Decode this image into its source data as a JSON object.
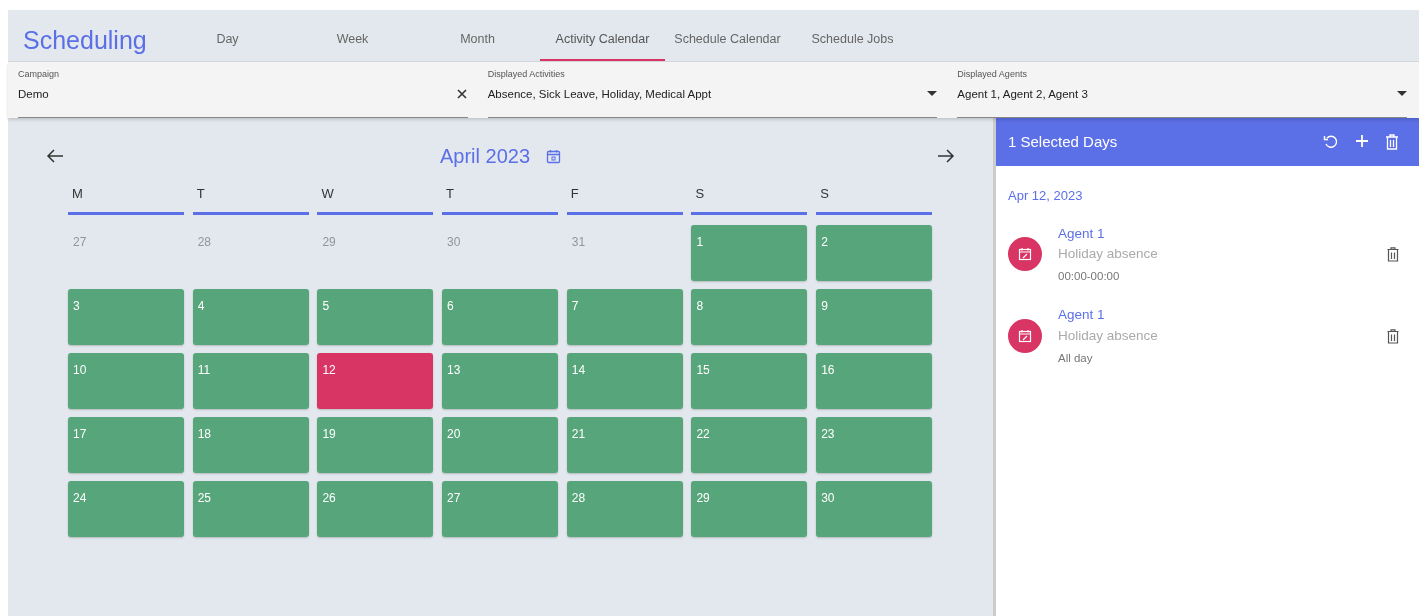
{
  "app_title": "Scheduling",
  "tabs": [
    {
      "label": "Day",
      "selected": false
    },
    {
      "label": "Week",
      "selected": false
    },
    {
      "label": "Month",
      "selected": false
    },
    {
      "label": "Activity Calendar",
      "selected": true
    },
    {
      "label": "Schedule Calendar",
      "selected": false
    },
    {
      "label": "Schedule Jobs",
      "selected": false
    }
  ],
  "filters": [
    {
      "label": "Campaign",
      "value": "Demo",
      "kind": "clearable"
    },
    {
      "label": "Displayed Activities",
      "value": "Absence, Sick Leave, Holiday, Medical Appt",
      "kind": "dropdown"
    },
    {
      "label": "Displayed Agents",
      "value": "Agent 1, Agent 2, Agent 3",
      "kind": "dropdown"
    }
  ],
  "calendar": {
    "month": "April 2023",
    "weekdays": [
      "M",
      "T",
      "W",
      "T",
      "F",
      "S",
      "S"
    ],
    "days": [
      {
        "day": "27",
        "kind": "outside",
        "selected": false
      },
      {
        "day": "28",
        "kind": "outside",
        "selected": false
      },
      {
        "day": "29",
        "kind": "outside",
        "selected": false
      },
      {
        "day": "30",
        "kind": "outside",
        "selected": false
      },
      {
        "day": "31",
        "kind": "outside",
        "selected": false
      },
      {
        "day": "1",
        "kind": "current",
        "selected": false
      },
      {
        "day": "2",
        "kind": "current",
        "selected": false
      },
      {
        "day": "3",
        "kind": "current",
        "selected": false
      },
      {
        "day": "4",
        "kind": "current",
        "selected": false
      },
      {
        "day": "5",
        "kind": "current",
        "selected": false
      },
      {
        "day": "6",
        "kind": "current",
        "selected": false
      },
      {
        "day": "7",
        "kind": "current",
        "selected": false
      },
      {
        "day": "8",
        "kind": "current",
        "selected": false
      },
      {
        "day": "9",
        "kind": "current",
        "selected": false
      },
      {
        "day": "10",
        "kind": "current",
        "selected": false
      },
      {
        "day": "11",
        "kind": "current",
        "selected": false
      },
      {
        "day": "12",
        "kind": "current",
        "selected": true
      },
      {
        "day": "13",
        "kind": "current",
        "selected": false
      },
      {
        "day": "14",
        "kind": "current",
        "selected": false
      },
      {
        "day": "15",
        "kind": "current",
        "selected": false
      },
      {
        "day": "16",
        "kind": "current",
        "selected": false
      },
      {
        "day": "17",
        "kind": "current",
        "selected": false
      },
      {
        "day": "18",
        "kind": "current",
        "selected": false
      },
      {
        "day": "19",
        "kind": "current",
        "selected": false
      },
      {
        "day": "20",
        "kind": "current",
        "selected": false
      },
      {
        "day": "21",
        "kind": "current",
        "selected": false
      },
      {
        "day": "22",
        "kind": "current",
        "selected": false
      },
      {
        "day": "23",
        "kind": "current",
        "selected": false
      },
      {
        "day": "24",
        "kind": "current",
        "selected": false
      },
      {
        "day": "25",
        "kind": "current",
        "selected": false
      },
      {
        "day": "26",
        "kind": "current",
        "selected": false
      },
      {
        "day": "27",
        "kind": "current",
        "selected": false
      },
      {
        "day": "28",
        "kind": "current",
        "selected": false
      },
      {
        "day": "29",
        "kind": "current",
        "selected": false
      },
      {
        "day": "30",
        "kind": "current",
        "selected": false
      }
    ]
  },
  "panel": {
    "title": "1 Selected Days",
    "date": "Apr 12, 2023",
    "entries": [
      {
        "agent": "Agent 1",
        "activity": "Holiday absence",
        "time": "00:00-00:00"
      },
      {
        "agent": "Agent 1",
        "activity": "Holiday absence",
        "time": "All day"
      }
    ]
  }
}
